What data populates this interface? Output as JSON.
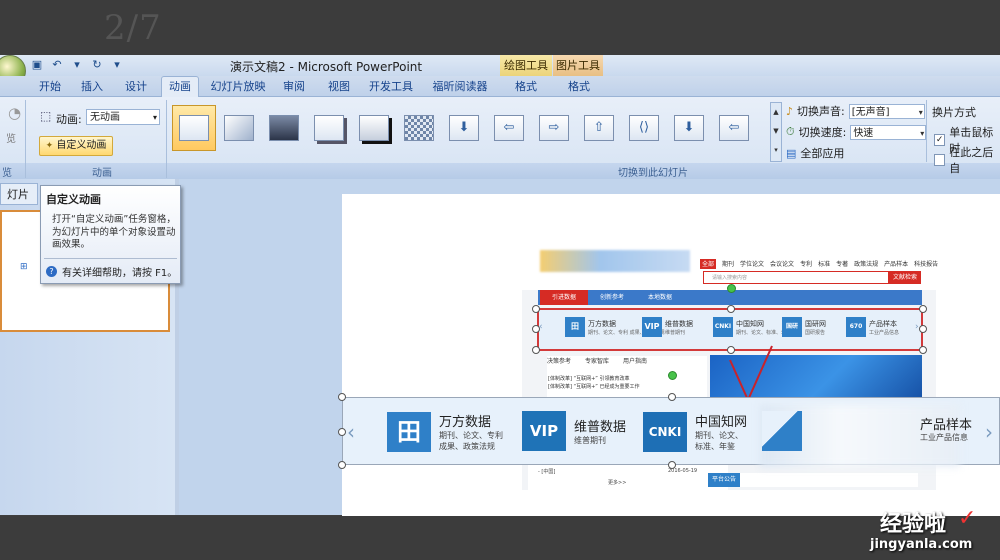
{
  "background_number": "2/7",
  "app": {
    "doc_title": "演示文稿2 - Microsoft PowerPoint",
    "contextual_groups": [
      "绘图工具",
      "图片工具"
    ]
  },
  "tabs": [
    "开始",
    "插入",
    "设计",
    "动画",
    "幻灯片放映",
    "审阅",
    "视图",
    "开发工具",
    "福昕阅读器",
    "格式",
    "格式"
  ],
  "ribbon": {
    "left_stub_label": "览",
    "animation_label": "动画:",
    "animation_value": "无动画",
    "custom_animation_button": "自定义动画",
    "group_animation": "动画",
    "group_transition": "切换到此幻灯片",
    "sound_label": "切换声音:",
    "sound_value": "[无声音]",
    "speed_label": "切换速度:",
    "speed_value": "快速",
    "apply_all": "全部应用",
    "advance_title": "换片方式",
    "on_click": "单击鼠标时",
    "after_auto": "在此之后自"
  },
  "left_pane": {
    "tab_label": "灯片"
  },
  "tooltip": {
    "title": "自定义动画",
    "body": "打开“自定义动画”任务窗格，为幻灯片中的单个对象设置动画效果。",
    "help": "有关详细帮助，请按 F1。"
  },
  "website": {
    "nav": [
      "全部",
      "期刊",
      "学位论文",
      "会议论文",
      "专利",
      "标准",
      "专著",
      "政策法规",
      "产品样本",
      "科技报告"
    ],
    "search_placeholder": "请输入搜索内容",
    "search_button": "文献检索",
    "blue_tabs": [
      "引进数据",
      "创新参考",
      "本地数据"
    ],
    "databases_small": [
      {
        "icon": "万方",
        "name": "万方数据",
        "sub": "期刊、论文、专利 成果、政策法规"
      },
      {
        "icon": "VIP",
        "name": "维普数据",
        "sub": "维普期刊"
      },
      {
        "icon": "CNKI",
        "name": "中国知网",
        "sub": "期刊、论文、标准、年鉴"
      },
      {
        "icon": "国研",
        "name": "国研网",
        "sub": "国研报告"
      },
      {
        "icon": "670",
        "name": "产品样本",
        "sub": "工业产品信息"
      }
    ],
    "lower_tabs": [
      "决策参考",
      "专家智库",
      "用户指南"
    ],
    "news_lines": [
      "[体制改革] “互联网+” 引领教育改革",
      "[体制改革] “互联网+” 已经成为重要工作"
    ],
    "bottom_line": "- [中国]",
    "date": "2016-05-19",
    "more": "更多>>",
    "bottom_right": "平台公告"
  },
  "big_strip": [
    {
      "icon": "田",
      "name": "万方数据",
      "sub1": "期刊、论文、专利",
      "sub2": "成果、政策法规"
    },
    {
      "icon": "VIP",
      "name": "维普数据",
      "sub1": "维普期刊",
      "sub2": ""
    },
    {
      "icon": "CNKI",
      "name": "中国知网",
      "sub1": "期刊、论文、",
      "sub2": "标准、年鉴"
    },
    {
      "icon": "",
      "name": "产品样本",
      "sub1": "工业产品信息",
      "sub2": ""
    }
  ],
  "watermark": {
    "text": "经验啦",
    "url": "jingyanla.com"
  }
}
